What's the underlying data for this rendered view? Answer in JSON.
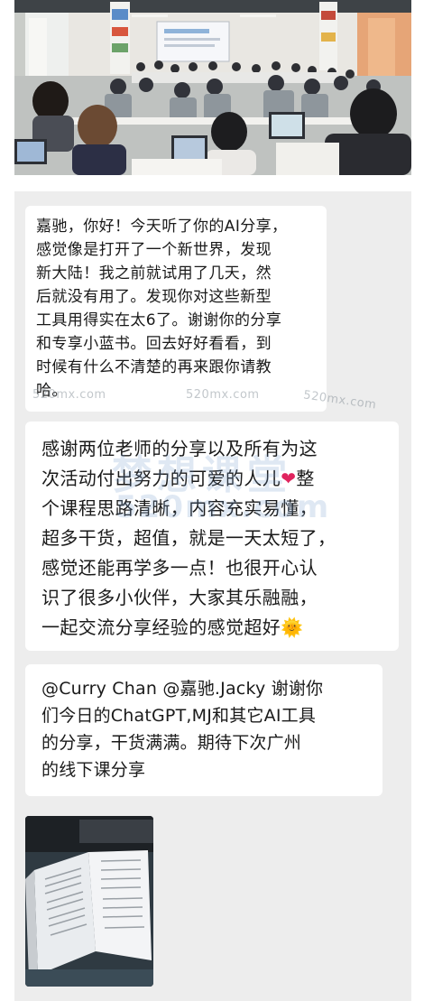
{
  "messages": [
    {
      "id": "msg-1",
      "text": "嘉驰，你好！今天听了你的AI分享，\n感觉像是打开了一个新世界，发现\n新大陆！我之前就试用了几天，然\n后就没有用了。发现你对这些新型\n工具用得实在太6了。谢谢你的分享\n和专享小蓝书。回去好好看看，到\n时候有什么不清楚的再来跟你请教\n哈。"
    },
    {
      "id": "msg-2",
      "text_before_emoji": "感谢两位老师的分享以及所有为这\n次活动付出努力的可爱的人儿",
      "emoji_1": "❤",
      "text_mid": "整\n个课程思路清晰，内容充实易懂，\n超多干货，超值，就是一天太短了，\n感觉还能再学多一点！也很开心认\n识了很多小伙伴，大家其乐融融，\n一起交流分享经验的感觉超好",
      "emoji_2": "🌞"
    },
    {
      "id": "msg-3",
      "text": "@Curry Chan @嘉驰.Jacky 谢谢你\n们今日的ChatGPT,MJ和其它AI工具\n的分享，干货满满。期待下次广州\n的线下课分享"
    }
  ],
  "watermarks": {
    "site": "520mx.com",
    "brand": "梦想课堂",
    "brand_site": "520mx.com"
  },
  "colors": {
    "chat_bg": "#ededed",
    "bubble_bg": "#ffffff",
    "text": "#1a1a1a",
    "heart": "#e0245e"
  }
}
